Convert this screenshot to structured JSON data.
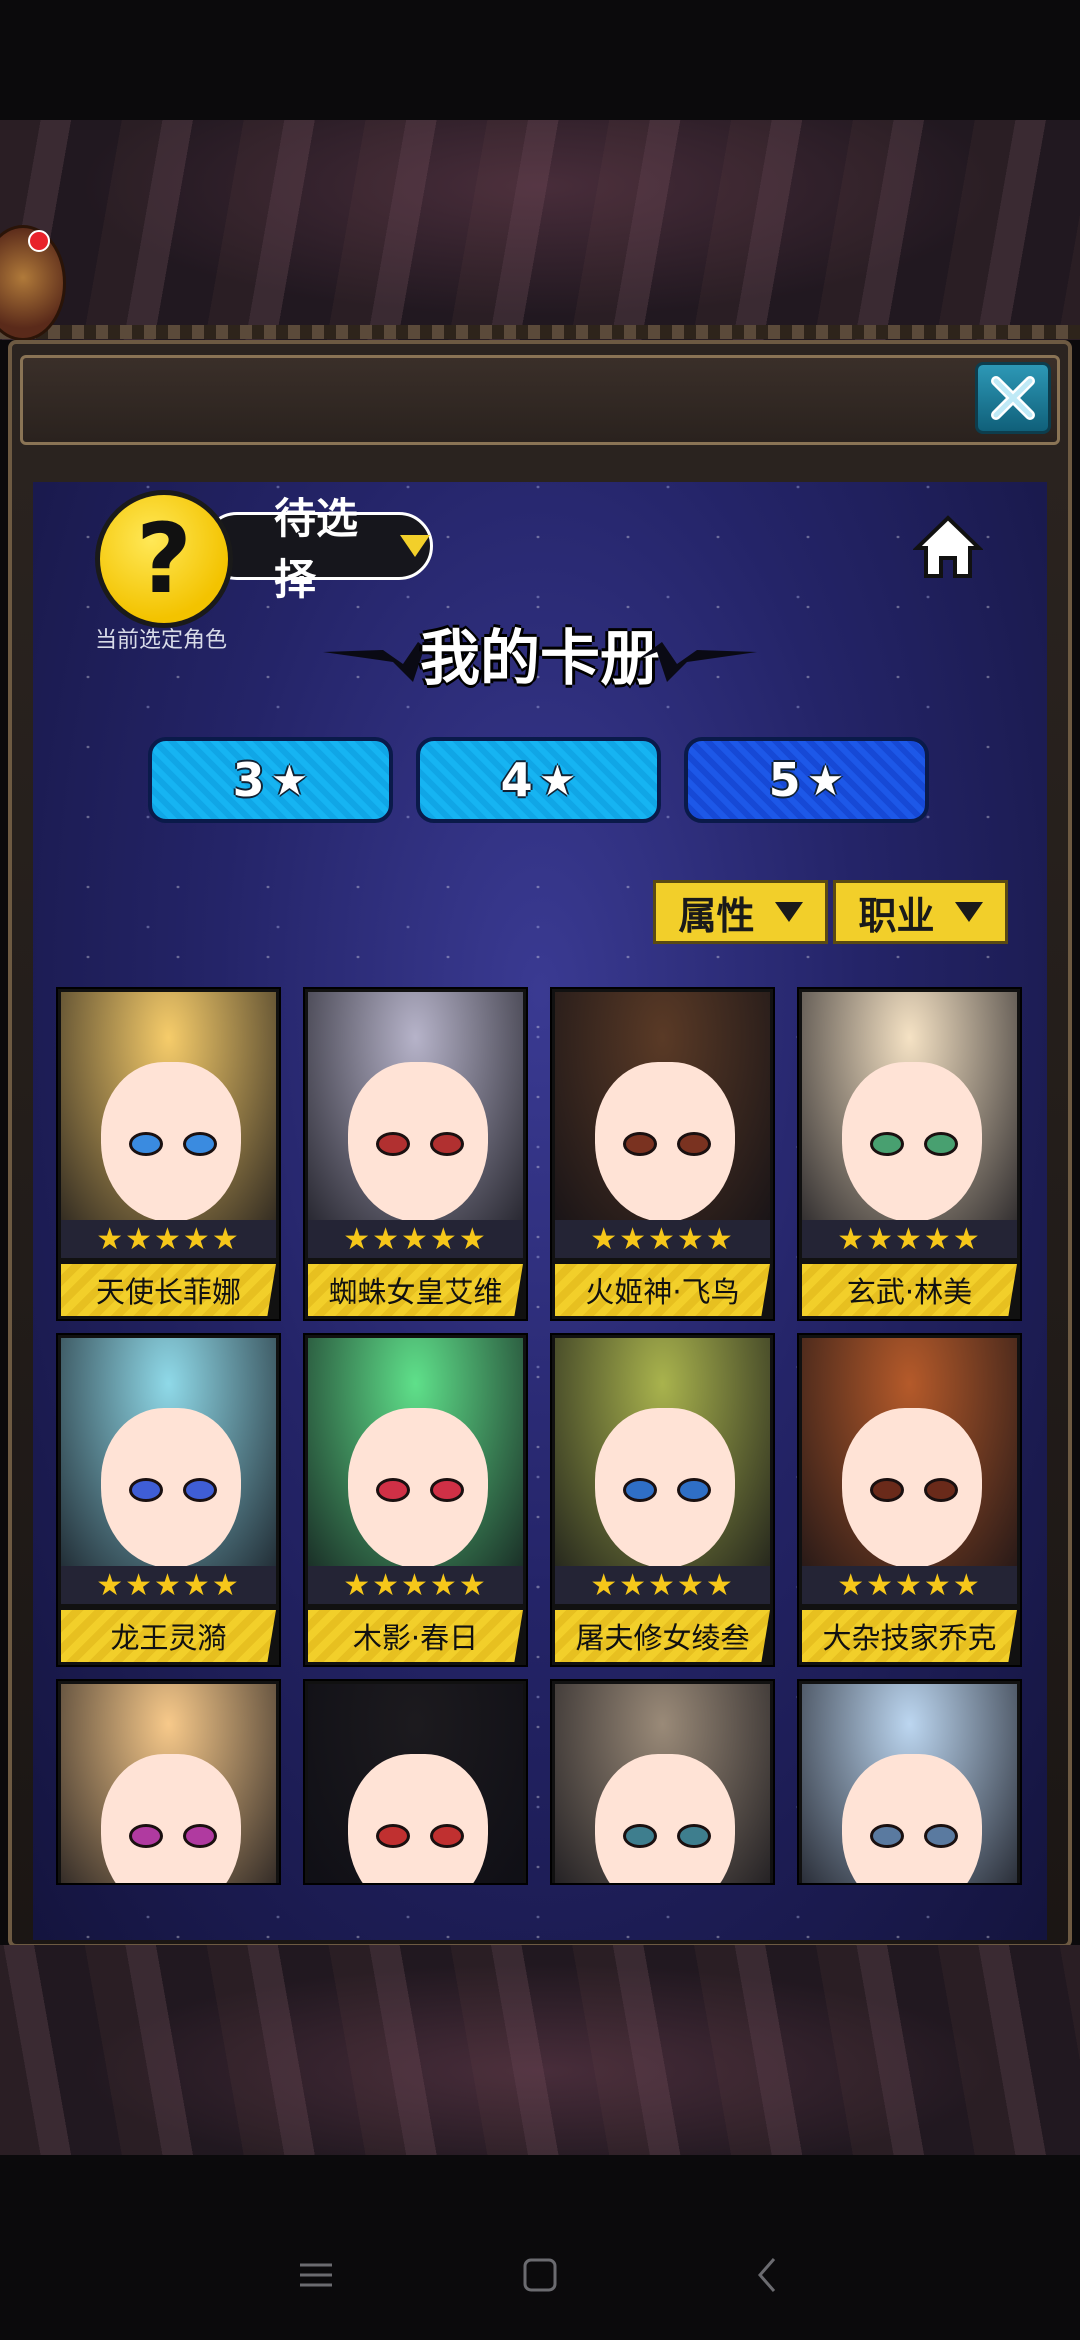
{
  "header": {
    "pending_label": "待选择",
    "current_role_label": "当前选定角色",
    "question_mark": "?"
  },
  "album": {
    "title": "我的卡册"
  },
  "star_tabs": [
    {
      "value": "3",
      "star": "★"
    },
    {
      "value": "4",
      "star": "★"
    },
    {
      "value": "5",
      "star": "★",
      "active": true
    }
  ],
  "filters": {
    "attribute": "属性",
    "job": "职业"
  },
  "cards": [
    {
      "name": "天使长菲娜",
      "rating": "★★★★★",
      "hair": "#f6cc6a",
      "eye": "#3a8be0"
    },
    {
      "name": "蜘蛛女皇艾维",
      "rating": "★★★★★",
      "hair": "#b6b3c9",
      "eye": "#b13030"
    },
    {
      "name": "火姬神·飞鸟",
      "rating": "★★★★★",
      "hair": "#5a3a26",
      "eye": "#7a3220"
    },
    {
      "name": "玄武·林美",
      "rating": "★★★★★",
      "hair": "#f5e2c4",
      "eye": "#48a070"
    },
    {
      "name": "龙王灵漪",
      "rating": "★★★★★",
      "hair": "#8fd9e8",
      "eye": "#3f5ed6"
    },
    {
      "name": "木影·春日",
      "rating": "★★★★★",
      "hair": "#5fe08a",
      "eye": "#d03046"
    },
    {
      "name": "屠夫修女绫叁",
      "rating": "★★★★★",
      "hair": "#a9b34d",
      "eye": "#2f6fc6"
    },
    {
      "name": "大杂技家乔克",
      "rating": "★★★★★",
      "hair": "#b55a2a",
      "eye": "#6a2a1a"
    },
    {
      "name": "",
      "rating": "",
      "hair": "#f7c98a",
      "eye": "#b03aa0"
    },
    {
      "name": "",
      "rating": "",
      "hair": "#1c1a1e",
      "eye": "#c03030"
    },
    {
      "name": "",
      "rating": "",
      "hair": "#9a8a78",
      "eye": "#3e7e8e"
    },
    {
      "name": "",
      "rating": "",
      "hair": "#bcd6f0",
      "eye": "#5a7aa0"
    }
  ],
  "colors": {
    "panel": "#242468",
    "accent_yellow": "#f2cf2a",
    "tab_blue": "#16b4f2",
    "tab_active": "#1d58e8"
  },
  "icons": {
    "close": "close-icon",
    "home": "home-icon",
    "question": "question-mark-icon",
    "nav_menu": "menu-icon",
    "nav_home": "square-icon",
    "nav_back": "back-icon"
  }
}
